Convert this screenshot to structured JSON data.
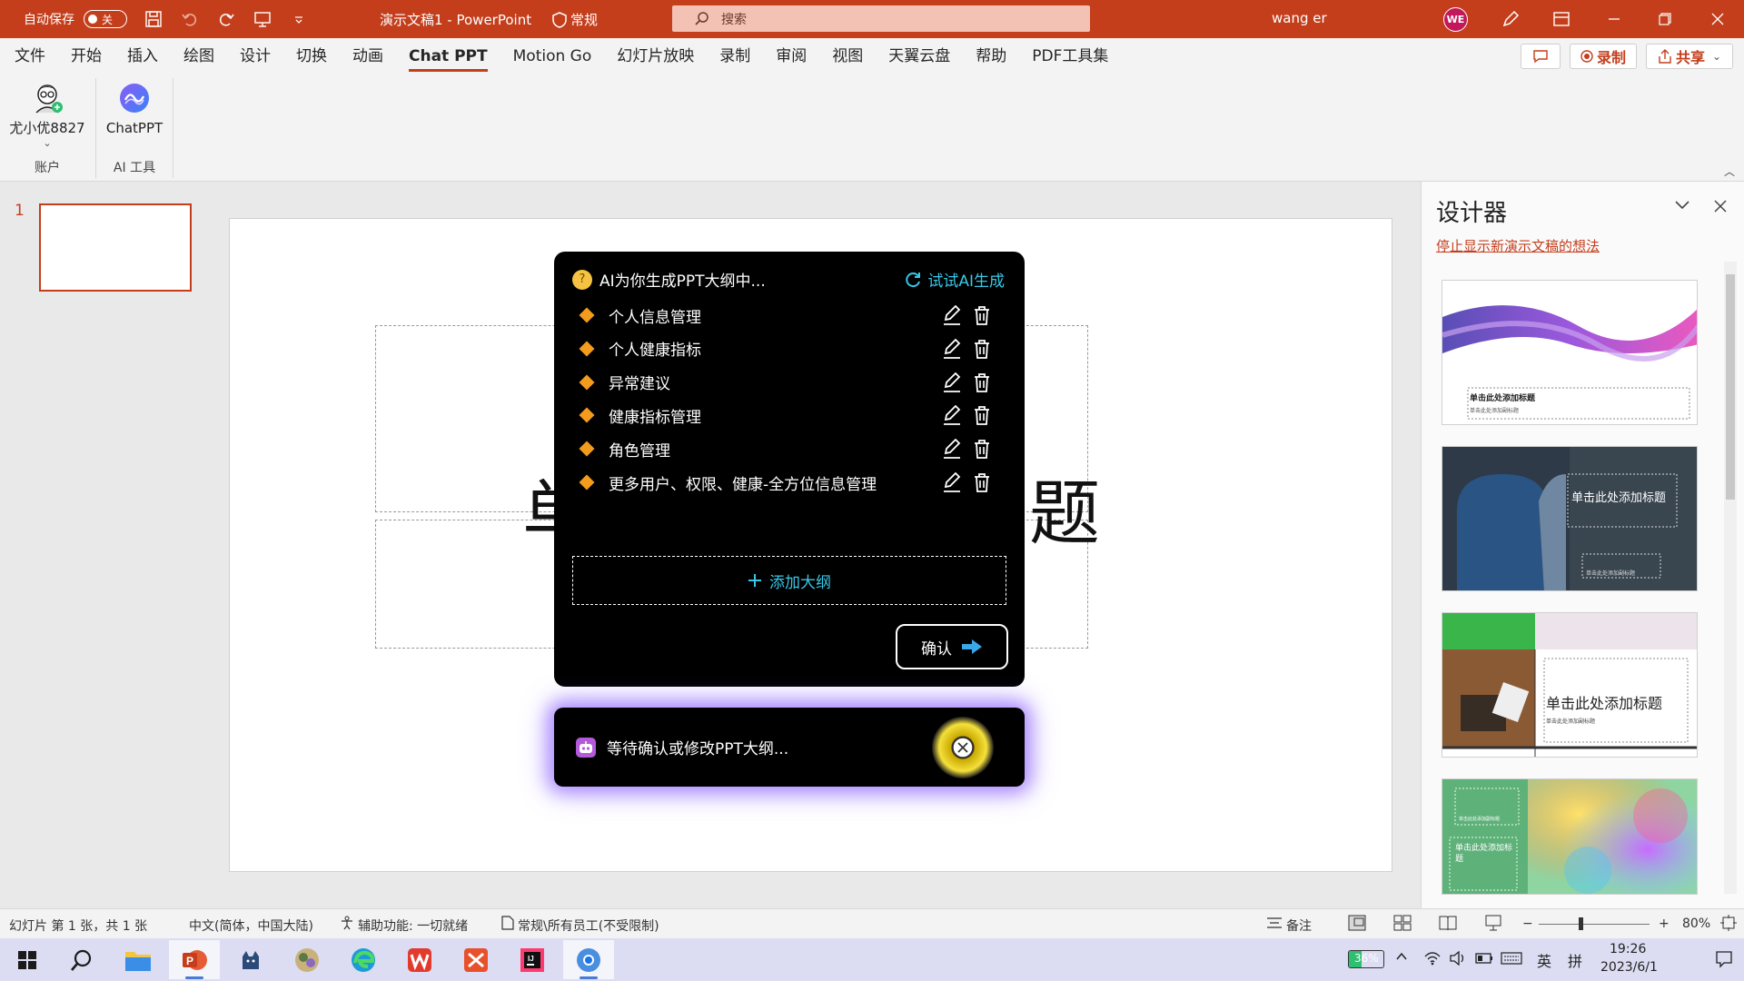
{
  "titlebar": {
    "autosave_label": "自动保存",
    "autosave_state": "关",
    "doc_title": "演示文稿1 - PowerPoint",
    "policy_label": "常规",
    "search_placeholder": "搜索",
    "user_name": "wang er",
    "user_initials": "WE"
  },
  "ribbon": {
    "tabs": [
      "文件",
      "开始",
      "插入",
      "绘图",
      "设计",
      "切换",
      "动画",
      "Chat PPT",
      "Motion Go",
      "幻灯片放映",
      "录制",
      "审阅",
      "视图",
      "天翼云盘",
      "帮助",
      "PDF工具集"
    ],
    "active_tab": "Chat PPT",
    "record_label": "录制",
    "share_label": "共享",
    "account_button": "尤小优8827",
    "account_group": "账户",
    "chatppt_button": "ChatPPT",
    "ai_group": "AI 工具"
  },
  "thumbnails": {
    "slide_number": "1"
  },
  "slide": {
    "title_left": "单",
    "title_right": "题"
  },
  "dialog": {
    "header": "AI为你生成PPT大纲中...",
    "retry": "试试AI生成",
    "outline": [
      "个人信息管理",
      "个人健康指标",
      "异常建议",
      "健康指标管理",
      "角色管理",
      "更多用户、权限、健康-全方位信息管理"
    ],
    "add_outline": "添加大纲",
    "confirm": "确认"
  },
  "waiting": {
    "text": "等待确认或修改PPT大纲..."
  },
  "designer": {
    "title": "设计器",
    "stop_link": "停止显示新演示文稿的想法",
    "cards": [
      {
        "main": "单击此处添加标题",
        "sub": "单击此处添加副标题"
      },
      {
        "main": "单击此处添加标题",
        "sub": "单击此处添加副标题"
      },
      {
        "main": "单击此处添加标题",
        "sub": "单击此处添加副标题"
      },
      {
        "main": "单击此处添加标题",
        "sub": "单击此处添加副标题"
      }
    ]
  },
  "status": {
    "slide_info": "幻灯片 第 1 张，共 1 张",
    "language": "中文(简体，中国大陆)",
    "accessibility": "辅助功能: 一切就绪",
    "sensitivity": "常规\\所有员工(不受限制)",
    "notes": "备注",
    "zoom": "80%"
  },
  "taskbar": {
    "battery": "36%",
    "ime_lang": "英",
    "ime_mode": "拼",
    "time": "19:26",
    "date": "2023/6/1"
  },
  "colors": {
    "accent": "#c43e1c",
    "cyan": "#39c7e6",
    "diamond": "#f39b1c"
  }
}
